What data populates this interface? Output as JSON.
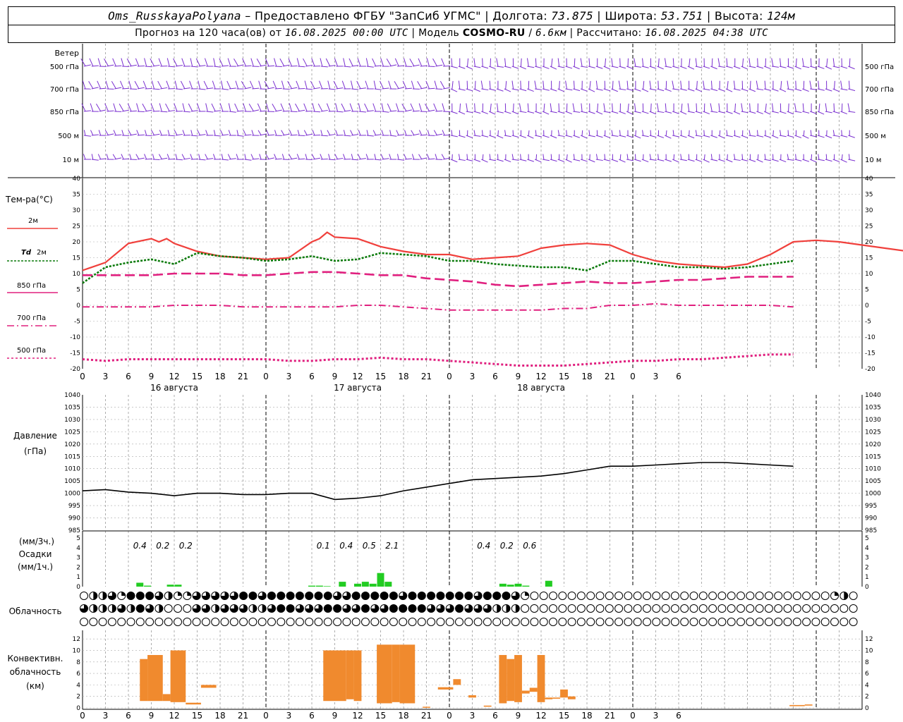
{
  "header": {
    "station": "Oms_RusskayaPolyana",
    "provider": "Предоставлено ФГБУ \"ЗапСиб УГМС\"",
    "lon_label": "Долгота:",
    "lon": "73.875",
    "lat_label": "Широта:",
    "lat": "53.751",
    "alt_label": "Высота:",
    "alt": "124м",
    "forecast_prefix": "Прогноз на 120 часа(ов) от",
    "forecast_time": "16.08.2025 00:00 UTC",
    "model_label": "Модель",
    "model": "COSMO-RU",
    "resolution": "6.6км",
    "computed_label": "Рассчитано:",
    "computed_time": "16.08.2025 04:38 UTC"
  },
  "labels": {
    "wind": "Ветер",
    "wind_levels": [
      "500 гПа",
      "700 гПа",
      "850 гПа",
      "500 м",
      "10 м"
    ],
    "temp": "Тем-ра(°C)",
    "t2m": "2м",
    "td": "Td",
    "td2": "2м",
    "t850": "850 гПа",
    "t700": "700 гПа",
    "t500": "500 гПа",
    "pressure": "Давление",
    "pressure_unit": "(гПа)",
    "precip_unit3": "(мм/3ч.)",
    "precip": "Осадки",
    "precip_unit1": "(мм/1ч.)",
    "cloud": "Облачность",
    "conv1": "Конвективн.",
    "conv2": "облачность",
    "conv3": "(км)"
  },
  "dates": [
    "16 августа",
    "17 августа",
    "18 августа"
  ],
  "hour_ticks": [
    "0",
    "3",
    "6",
    "9",
    "12",
    "15",
    "18",
    "21",
    "0",
    "3",
    "6",
    "9",
    "12",
    "15",
    "18",
    "21",
    "0",
    "3",
    "6",
    "9",
    "12",
    "15",
    "18",
    "21",
    "0",
    "3",
    "6"
  ],
  "colors": {
    "t2m": "#f0403c",
    "td": "#0a7a0a",
    "t850": "#e0207f",
    "t700": "#e0207f",
    "t500": "#e0207f",
    "wind": "#7a2fd0",
    "pressure": "#000000",
    "precip": "#22cc22",
    "conv": "#f08a2e"
  },
  "chart_data": [
    {
      "type": "line",
      "title": "Тем-ра(°C)",
      "x_unit": "hours since 16.08.2025 00:00 UTC",
      "ylim": [
        -20,
        40
      ],
      "series": [
        {
          "name": "2м",
          "x": [
            0,
            3,
            6,
            9,
            10,
            11,
            12,
            15,
            18,
            21,
            24,
            27,
            30,
            31,
            32,
            33,
            36,
            39,
            42,
            45,
            48,
            51,
            54,
            57,
            60,
            63,
            66,
            69,
            72,
            75,
            78,
            81,
            84,
            87,
            90,
            93,
            96,
            99,
            102,
            105,
            108
          ],
          "y": [
            11,
            13.5,
            19.5,
            21,
            20,
            21,
            19.5,
            17,
            15.5,
            15,
            14.5,
            15,
            20,
            21,
            23,
            21.5,
            21,
            18.5,
            17,
            16,
            16,
            14.5,
            15,
            15.5,
            18,
            19,
            19.5,
            19,
            16,
            14,
            13,
            12.5,
            12,
            13,
            16,
            20,
            20.5,
            20,
            19,
            18,
            17
          ]
        },
        {
          "name": "Td 2м",
          "x": [
            0,
            3,
            6,
            9,
            12,
            15,
            18,
            21,
            24,
            27,
            30,
            33,
            36,
            39,
            42,
            45,
            48,
            51,
            54,
            57,
            60,
            63,
            66,
            69,
            72,
            75,
            78,
            81,
            84,
            87,
            90,
            93
          ],
          "y": [
            7,
            12,
            13.5,
            14.5,
            13,
            16.5,
            15.5,
            15,
            14,
            14.5,
            15.5,
            14,
            14.5,
            16.5,
            16,
            15.5,
            14,
            14,
            13,
            12.5,
            12,
            12,
            11,
            14,
            14,
            13,
            12,
            12,
            11.5,
            12,
            13,
            14
          ]
        },
        {
          "name": "850 гПа",
          "x": [
            0,
            3,
            6,
            9,
            12,
            15,
            18,
            21,
            24,
            27,
            30,
            33,
            36,
            39,
            42,
            45,
            48,
            51,
            54,
            57,
            60,
            63,
            66,
            69,
            72,
            75,
            78,
            81,
            84,
            87,
            90,
            93
          ],
          "y": [
            9.5,
            9.5,
            9.5,
            9.5,
            10,
            10,
            10,
            9.5,
            9.5,
            10,
            10.5,
            10.5,
            10,
            9.5,
            9.5,
            8.5,
            8,
            7.5,
            6.5,
            6,
            6.5,
            7,
            7.5,
            7,
            7,
            7.5,
            8,
            8,
            8.5,
            9,
            9,
            9
          ]
        },
        {
          "name": "700 гПа",
          "x": [
            0,
            3,
            6,
            9,
            12,
            15,
            18,
            21,
            24,
            27,
            30,
            33,
            36,
            39,
            42,
            45,
            48,
            51,
            54,
            57,
            60,
            63,
            66,
            69,
            72,
            75,
            78,
            81,
            84,
            87,
            90,
            93
          ],
          "y": [
            -0.5,
            -0.5,
            -0.5,
            -0.5,
            0,
            0,
            0,
            -0.5,
            -0.5,
            -0.5,
            -0.5,
            -0.5,
            0,
            0,
            -0.5,
            -1,
            -1.5,
            -1.5,
            -1.5,
            -1.5,
            -1.5,
            -1,
            -1,
            0,
            0,
            0.5,
            0,
            0,
            0,
            0,
            0,
            -0.5
          ]
        },
        {
          "name": "500 гПа",
          "x": [
            0,
            3,
            6,
            9,
            12,
            15,
            18,
            21,
            24,
            27,
            30,
            33,
            36,
            39,
            42,
            45,
            48,
            51,
            54,
            57,
            60,
            63,
            66,
            69,
            72,
            75,
            78,
            81,
            84,
            87,
            90,
            93
          ],
          "y": [
            -17,
            -17.5,
            -17,
            -17,
            -17,
            -17,
            -17,
            -17,
            -17,
            -17.5,
            -17.5,
            -17,
            -17,
            -16.5,
            -17,
            -17,
            -17.5,
            -18,
            -18.5,
            -19,
            -19,
            -19,
            -18.5,
            -18,
            -17.5,
            -17.5,
            -17,
            -17,
            -16.5,
            -16,
            -15.5,
            -15.5
          ]
        }
      ]
    },
    {
      "type": "line",
      "title": "Давление (гПа)",
      "x_unit": "hours since 16.08.2025 00:00 UTC",
      "ylim": [
        985,
        1040
      ],
      "series": [
        {
          "name": "Давление",
          "x": [
            0,
            3,
            6,
            9,
            12,
            15,
            18,
            21,
            24,
            27,
            30,
            33,
            36,
            39,
            42,
            45,
            48,
            51,
            54,
            57,
            60,
            63,
            66,
            69,
            72,
            75,
            78,
            81,
            84,
            87,
            90,
            93
          ],
          "y": [
            1001,
            1001.5,
            1000.5,
            1000,
            999,
            1000,
            1000,
            999.5,
            999.5,
            1000,
            1000,
            997.5,
            998,
            999,
            1001,
            1002.5,
            1004,
            1005.5,
            1006,
            1006.5,
            1007,
            1008,
            1009.5,
            1011,
            1011,
            1011.5,
            1012,
            1012.5,
            1012.5,
            1012,
            1011.5,
            1011
          ]
        }
      ]
    },
    {
      "type": "bar",
      "title": "Осадки",
      "x_unit": "hours since 16.08.2025 00:00 UTC",
      "ylim": [
        0,
        5
      ],
      "series": [
        {
          "name": "мм/1ч.",
          "x": [
            7.5,
            8.5,
            11.5,
            12.5,
            30,
            31,
            32,
            34,
            36,
            37,
            38,
            39,
            40
          ],
          "y": [
            0.4,
            0.1,
            0.2,
            0.2,
            0.1,
            0.1,
            0.05,
            0.5,
            0.3,
            0.5,
            0.3,
            1.4,
            0.5
          ]
        },
        {
          "name": "мм/1ч. (18 августа)",
          "x": [
            55,
            56,
            57,
            58,
            61
          ],
          "y": [
            0.3,
            0.2,
            0.3,
            0.1,
            0.6
          ]
        }
      ],
      "annotations_3h": [
        {
          "x": 7.5,
          "text": "0.4"
        },
        {
          "x": 10.5,
          "text": "0.2"
        },
        {
          "x": 13.5,
          "text": "0.2"
        },
        {
          "x": 31.5,
          "text": "0.1"
        },
        {
          "x": 34.5,
          "text": "0.4"
        },
        {
          "x": 37.5,
          "text": "0.5"
        },
        {
          "x": 40.5,
          "text": "2.1"
        },
        {
          "x": 52.5,
          "text": "0.4"
        },
        {
          "x": 55.5,
          "text": "0.2"
        },
        {
          "x": 58.5,
          "text": "0.6"
        }
      ]
    },
    {
      "type": "bar",
      "title": "Конвективн. облачность (км)",
      "x_unit": "hours since 16.08.2025 00:00 UTC",
      "ylim": [
        0,
        13
      ],
      "series": [
        {
          "name": "conv",
          "ranges": [
            [
              7.5,
              8.5,
              1.2,
              8.5
            ],
            [
              8.5,
              10.5,
              1.2,
              9.2
            ],
            [
              10.5,
              11.5,
              1.2,
              2.4
            ],
            [
              11.5,
              13.5,
              1.0,
              10
            ],
            [
              13.5,
              15.5,
              0.6,
              0.9
            ],
            [
              15.5,
              17.5,
              3.5,
              4
            ],
            [
              31.5,
              34.5,
              1.2,
              10
            ],
            [
              34.5,
              35.5,
              1.5,
              10
            ],
            [
              35.5,
              36.5,
              1.2,
              10
            ],
            [
              38.5,
              40.5,
              0.8,
              11
            ],
            [
              40.5,
              41.5,
              1.0,
              11
            ],
            [
              41.5,
              43.5,
              0.8,
              11
            ],
            [
              44.5,
              45.5,
              0.1,
              0.2
            ],
            [
              46.5,
              48.5,
              3.2,
              3.6
            ],
            [
              48.5,
              49.5,
              4,
              5
            ],
            [
              50.5,
              51.5,
              1.8,
              2.2
            ],
            [
              52.5,
              53.5,
              0.2,
              0.4
            ],
            [
              54.5,
              55.5,
              0.8,
              9.2
            ],
            [
              55.5,
              56.5,
              1.2,
              8.5
            ],
            [
              56.5,
              57.5,
              1.0,
              9.2
            ],
            [
              57.5,
              58.5,
              2.5,
              3
            ],
            [
              58.5,
              59.5,
              2.8,
              3.5
            ],
            [
              59.5,
              60.5,
              1.0,
              9.2
            ],
            [
              60.5,
              61.5,
              1.5,
              1.8
            ],
            [
              61.5,
              62.5,
              1.6,
              1.8
            ],
            [
              62.5,
              63.5,
              1.8,
              3.2
            ],
            [
              63.5,
              64.5,
              1.5,
              2
            ],
            [
              92.5,
              94.5,
              0.3,
              0.5
            ],
            [
              94.5,
              95.5,
              0.4,
              0.6
            ]
          ]
        }
      ]
    }
  ],
  "cloud_rows": {
    "note": "fraction codes 0..4 (eighths/2) for low, mid, high rows",
    "row1": [
      0,
      2,
      2,
      3,
      1,
      4,
      4,
      4,
      3,
      2,
      1,
      1,
      3,
      3,
      3,
      3,
      3,
      4,
      4,
      3,
      4,
      4,
      4,
      4,
      4,
      4,
      4,
      3,
      3,
      4,
      4,
      4,
      4,
      4,
      3,
      4,
      4,
      4,
      4,
      4,
      4,
      4,
      3,
      4,
      4,
      4,
      3,
      1,
      0,
      0,
      0,
      0,
      0,
      0,
      0,
      0,
      0,
      0,
      0,
      0,
      0,
      0,
      0,
      0,
      0,
      0,
      0,
      0,
      0,
      0,
      0,
      0,
      0,
      0,
      0,
      0,
      0,
      0,
      0,
      0,
      1,
      2,
      0
    ],
    "row2": [
      3,
      2,
      2,
      2,
      3,
      2,
      4,
      3,
      2,
      0,
      0,
      0,
      3,
      3,
      2,
      3,
      3,
      3,
      2,
      2,
      3,
      4,
      4,
      3,
      3,
      3,
      4,
      4,
      3,
      3,
      4,
      3,
      3,
      4,
      4,
      4,
      4,
      3,
      3,
      3,
      4,
      3,
      3,
      3,
      2,
      2,
      2,
      0,
      0,
      0,
      0,
      0,
      0,
      0,
      0,
      0,
      0,
      0,
      0,
      0,
      0,
      0,
      0,
      0,
      0,
      0,
      0,
      0,
      0,
      0,
      0,
      0,
      0,
      0,
      0,
      0,
      0,
      0,
      0,
      0,
      0,
      0,
      0
    ],
    "row3": [
      0,
      0,
      0,
      0,
      0,
      0,
      0,
      0,
      0,
      0,
      0,
      0,
      0,
      0,
      0,
      0,
      0,
      0,
      0,
      0,
      0,
      0,
      0,
      0,
      0,
      0,
      0,
      0,
      0,
      0,
      0,
      0,
      0,
      0,
      0,
      0,
      0,
      0,
      0,
      0,
      0,
      0,
      0,
      0,
      0,
      0,
      0,
      0,
      0,
      0,
      0,
      0,
      0,
      0,
      0,
      0,
      0,
      0,
      0,
      0,
      0,
      0,
      0,
      0,
      0,
      0,
      0,
      0,
      0,
      0,
      0,
      0,
      0,
      0,
      0,
      0,
      0,
      0,
      0,
      0,
      0,
      0,
      0
    ]
  }
}
